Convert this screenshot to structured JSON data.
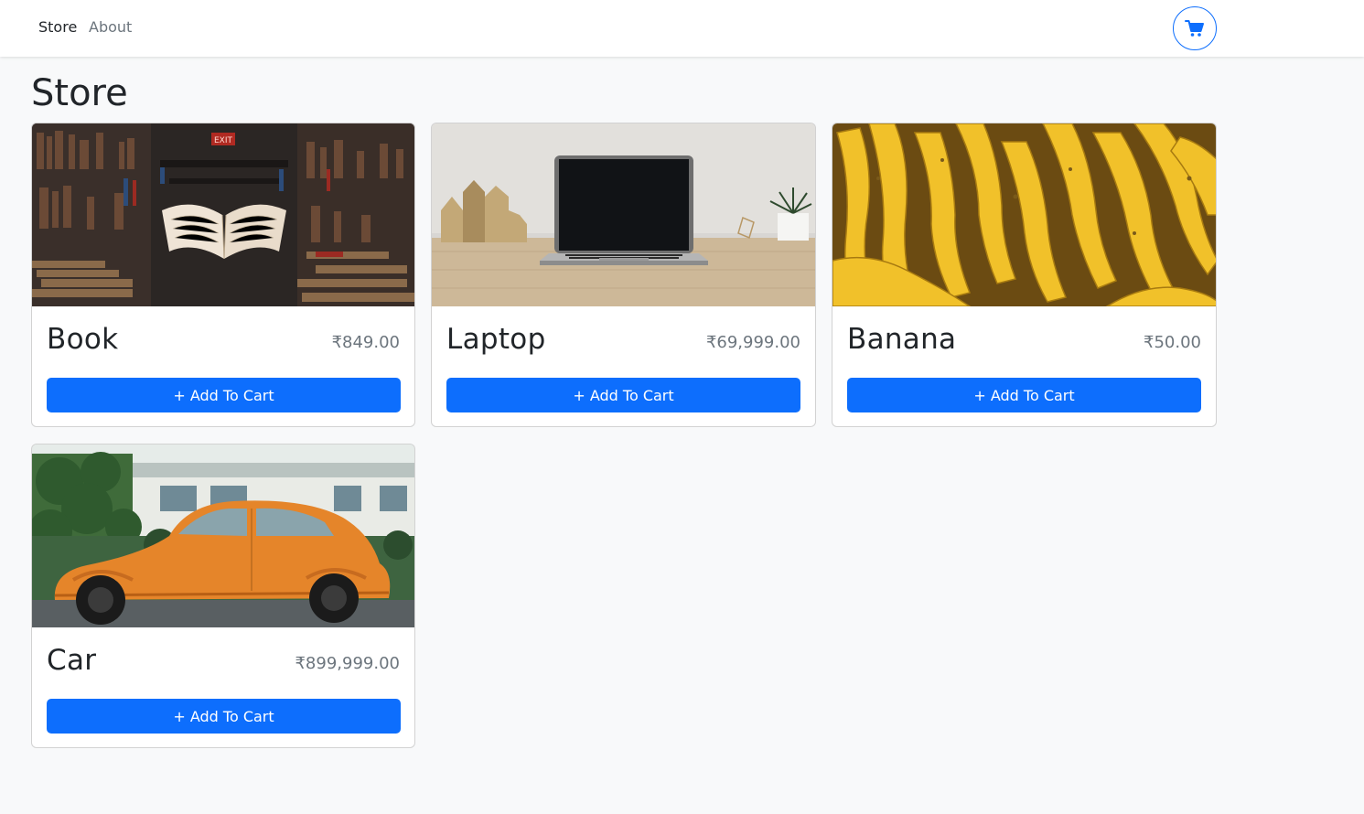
{
  "navbar": {
    "links": [
      {
        "label": "Store"
      },
      {
        "label": "About"
      }
    ],
    "cart_icon": "shopping-cart-icon",
    "accent_color": "#0d6efd"
  },
  "page": {
    "title": "Store"
  },
  "products": [
    {
      "name": "Book",
      "price": "₹849.00",
      "button": "+ Add To Cart",
      "image": "book-photo"
    },
    {
      "name": "Laptop",
      "price": "₹69,999.00",
      "button": "+ Add To Cart",
      "image": "laptop-photo"
    },
    {
      "name": "Banana",
      "price": "₹50.00",
      "button": "+ Add To Cart",
      "image": "banana-photo"
    },
    {
      "name": "Car",
      "price": "₹899,999.00",
      "button": "+ Add To Cart",
      "image": "car-photo"
    }
  ]
}
